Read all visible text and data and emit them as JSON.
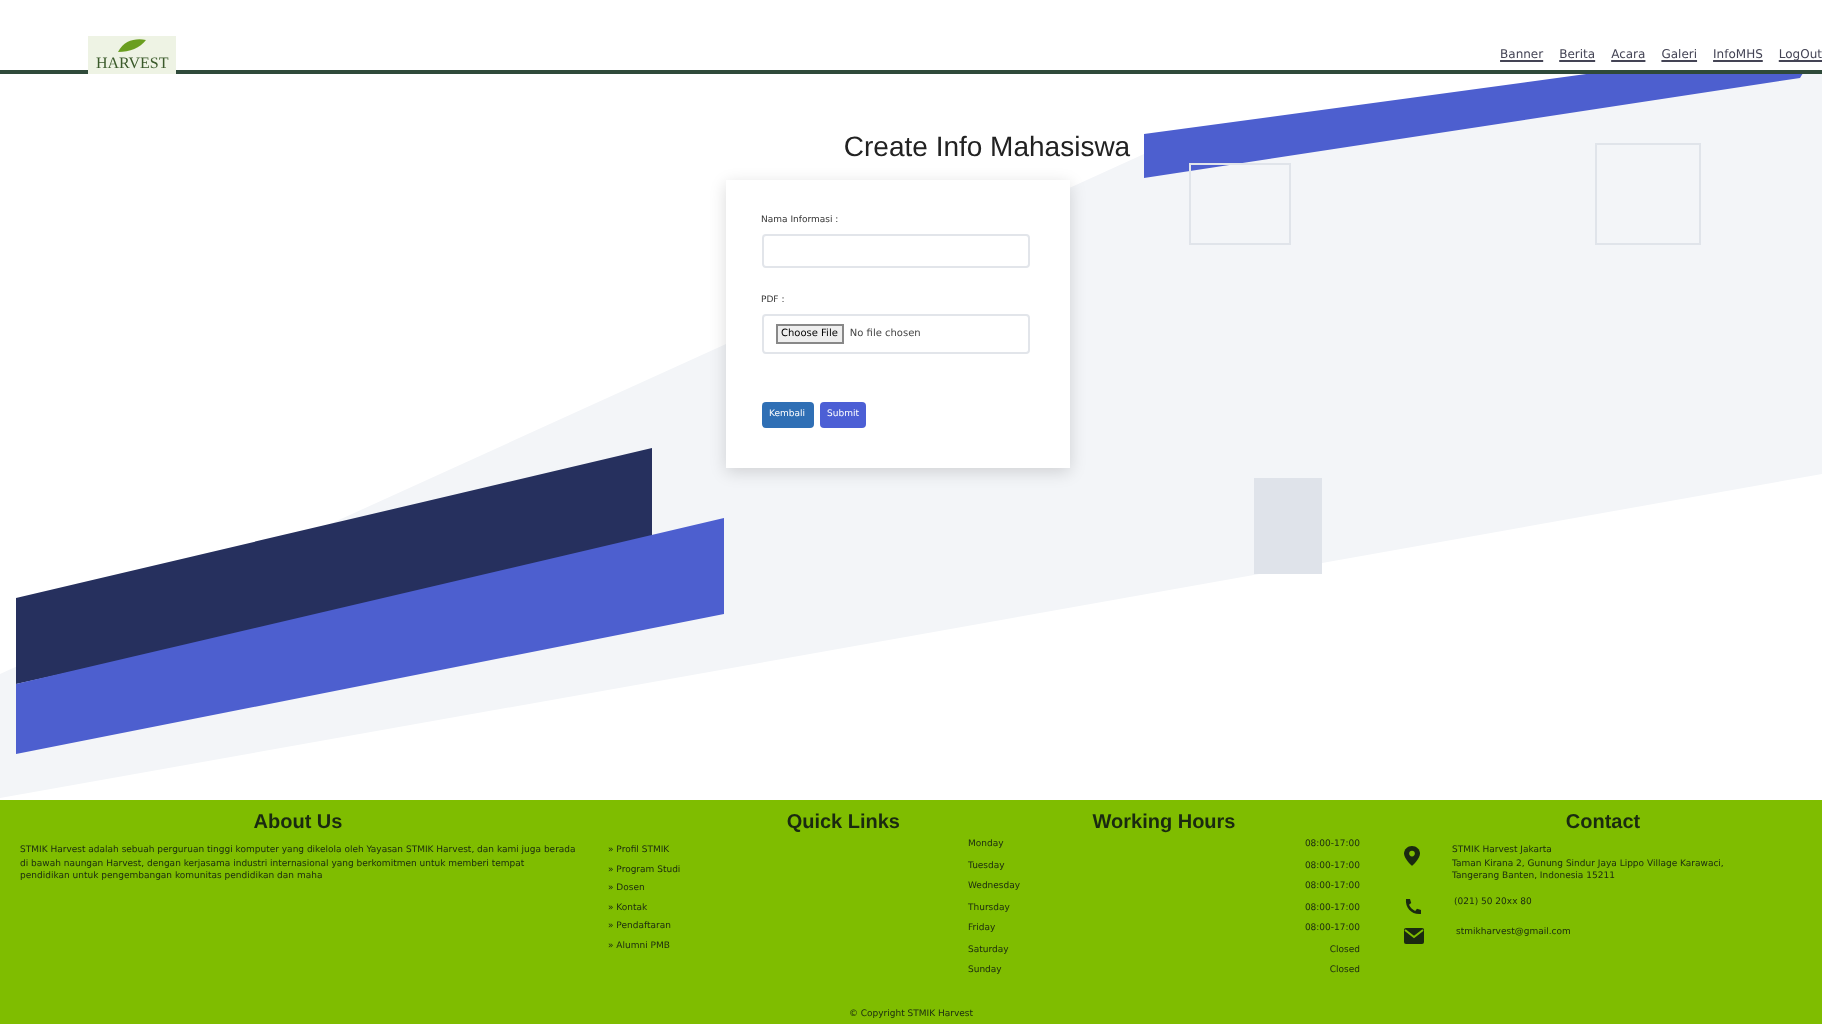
{
  "header": {
    "logo_text": "HARVEST",
    "nav": [
      {
        "label": "Banner"
      },
      {
        "label": "Berita"
      },
      {
        "label": "Acara"
      },
      {
        "label": "Galeri"
      },
      {
        "label": "InfoMHS"
      },
      {
        "label": "LogOut"
      }
    ]
  },
  "form": {
    "title": "Create Info Mahasiswa",
    "fields": [
      {
        "kind": "text",
        "label": "Nama Informasi :"
      },
      {
        "kind": "file",
        "label": "PDF :",
        "button": "Choose File",
        "status": "No file chosen"
      }
    ],
    "buttons": [
      {
        "kind": "secondary",
        "label": "Kembali"
      },
      {
        "kind": "primary",
        "label": "Submit"
      }
    ]
  },
  "footer": {
    "about": {
      "title": "About Us",
      "text": "STMIK Harvest adalah sebuah perguruan tinggi komputer yang dikelola oleh Yayasan STMIK Harvest, dan kami juga berada di bawah naungan Harvest, dengan kerjasama industri internasional yang berkomitmen untuk memberi tempat pendidikan untuk pengembangan komunitas pendidikan dan maha"
    },
    "links": {
      "title": "Quick Links",
      "items": [
        "» Profil STMIK",
        "» Program Studi",
        "» Dosen",
        "» Kontak",
        "» Pendaftaran",
        "» Alumni PMB"
      ]
    },
    "hours": {
      "title": "Working Hours",
      "rows": [
        {
          "day": "Monday",
          "time": "08:00-17:00"
        },
        {
          "day": "Tuesday",
          "time": "08:00-17:00"
        },
        {
          "day": "Wednesday",
          "time": "08:00-17:00"
        },
        {
          "day": "Thursday",
          "time": "08:00-17:00"
        },
        {
          "day": "Friday",
          "time": "08:00-17:00"
        },
        {
          "day": "Saturday",
          "time": "Closed"
        },
        {
          "day": "Sunday",
          "time": "Closed"
        }
      ]
    },
    "contact": {
      "title": "Contact",
      "items": [
        {
          "kind": "address",
          "lines": [
            "STMIK Harvest Jakarta",
            "Taman Kirana 2, Gunung Sindur Jaya Lippo Village Karawaci,",
            "Tangerang Banten, Indonesia 15211"
          ]
        },
        {
          "kind": "phone",
          "lines": [
            "(021) 50 20xx 80"
          ]
        },
        {
          "kind": "email",
          "lines": [
            "stmikharvest@gmail.com"
          ]
        }
      ]
    },
    "copyright": "© Copyright STMIK Harvest"
  }
}
